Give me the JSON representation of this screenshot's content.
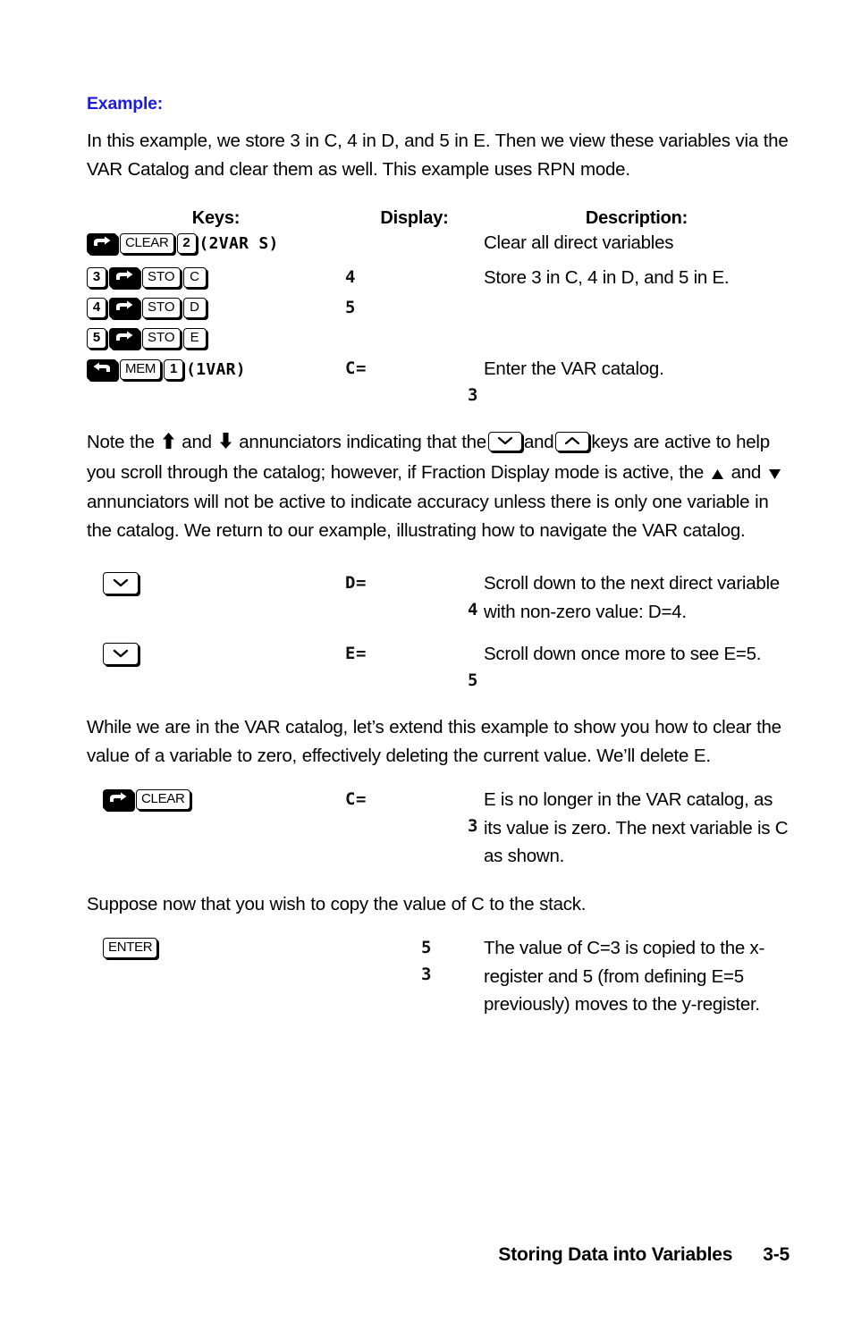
{
  "document": {
    "example_heading": "Example:",
    "intro_paragraph": "In this example, we store 3 in C, 4 in D, and 5 in E. Then we view these variables via the VAR Catalog and clear them as well. This example uses RPN mode.",
    "table_headers": {
      "keys": "Keys:",
      "display": "Display:",
      "description": "Description:"
    },
    "note_paragraph": {
      "part1": "Note the",
      "part2": "and",
      "part3": "annunciators indicating that the",
      "part4": "and",
      "part5": "keys are active to help you scroll through the catalog; however, if Fraction Display mode is active, the",
      "part6": "and",
      "part7": "annunciators will not be active to indicate accuracy unless there is only one variable in the catalog. We return to our example, illustrating how to navigate the VAR catalog.",
      "up_annunciator": "up-arrow-annunciator",
      "down_annunciator": "down-arrow-annunciator",
      "up_triangle": "up-triangle-annunciator",
      "down_triangle": "down-triangle-annunciator"
    },
    "clear_paragraph": "While we are in the VAR catalog, let’s extend this example to show you how to clear the value of a variable to zero, effectively deleting the current value. We’ll delete E.",
    "stack_paragraph": "Suppose now that you wish to copy the value of C to the stack.",
    "footer": {
      "title": "Storing Data into Variables",
      "page": "3-5"
    }
  },
  "rows": [
    {
      "id": "clear-all-vars",
      "keys": [
        {
          "type": "shift-right",
          "label": "right-shift"
        },
        {
          "type": "key",
          "label": "CLEAR"
        },
        {
          "type": "key-num",
          "label": "2"
        },
        {
          "type": "lcd-text",
          "label": "(2VAR S)"
        }
      ],
      "display_lines": [],
      "description": "Clear all direct variables"
    },
    {
      "id": "store-3-in-c",
      "keys": [
        {
          "type": "key-num",
          "label": "3"
        },
        {
          "type": "shift-right",
          "label": "right-shift"
        },
        {
          "type": "key",
          "label": "STO"
        },
        {
          "type": "key",
          "label": "C"
        }
      ],
      "display_lines": [
        {
          "align": "left",
          "text": "4"
        }
      ],
      "description": "Store 3 in C, 4 in D, and 5 in E."
    },
    {
      "id": "store-4-in-d",
      "keys": [
        {
          "type": "key-num",
          "label": "4"
        },
        {
          "type": "shift-right",
          "label": "right-shift"
        },
        {
          "type": "key",
          "label": "STO"
        },
        {
          "type": "key",
          "label": "D"
        }
      ],
      "display_lines": [
        {
          "align": "left",
          "text": "5"
        }
      ],
      "description": ""
    },
    {
      "id": "store-5-in-e",
      "keys": [
        {
          "type": "key-num",
          "label": "5"
        },
        {
          "type": "shift-right",
          "label": "right-shift"
        },
        {
          "type": "key",
          "label": "STO"
        },
        {
          "type": "key",
          "label": "E"
        }
      ],
      "display_lines": [],
      "description": ""
    },
    {
      "id": "enter-var-catalog",
      "keys": [
        {
          "type": "shift-left",
          "label": "left-shift"
        },
        {
          "type": "key",
          "label": "MEM"
        },
        {
          "type": "key-num",
          "label": "1"
        },
        {
          "type": "lcd-text",
          "label": "(1VAR)"
        }
      ],
      "display_lines": [
        {
          "align": "left",
          "text": "C="
        },
        {
          "align": "right",
          "text": "3"
        }
      ],
      "description": "Enter the VAR catalog."
    }
  ],
  "scroll_rows": [
    {
      "id": "scroll-down-to-d",
      "key": "down-arrow-key",
      "display_lines": [
        {
          "align": "left",
          "text": "D="
        },
        {
          "align": "right",
          "text": "4"
        }
      ],
      "description": "Scroll down to the next direct variable with non-zero value: D=4."
    },
    {
      "id": "scroll-down-to-e",
      "key": "down-arrow-key",
      "display_lines": [
        {
          "align": "left",
          "text": "E="
        },
        {
          "align": "right",
          "text": "5"
        }
      ],
      "description": "Scroll down once more to see E=5."
    }
  ],
  "clear_row": {
    "id": "clear-variable-e",
    "keys": [
      {
        "type": "shift-right",
        "label": "right-shift"
      },
      {
        "type": "key",
        "label": "CLEAR"
      }
    ],
    "display_lines": [
      {
        "align": "left",
        "text": "C="
      },
      {
        "align": "right",
        "text": "3"
      }
    ],
    "description": "E is no longer in the VAR catalog, as its value is zero. The next variable is C as shown."
  },
  "enter_row": {
    "id": "copy-c-to-stack",
    "keys": [
      {
        "type": "key",
        "label": "ENTER"
      }
    ],
    "display_lines": [
      {
        "align": "right",
        "text": "5"
      },
      {
        "align": "right",
        "text": "3"
      }
    ],
    "description": "The value of C=3 is copied to the x-register and 5 (from defining E=5 previously) moves to the y-register."
  },
  "colors": {
    "heading_blue": "#1a1ae0",
    "text_black": "#000000",
    "page_background": "#ffffff"
  }
}
